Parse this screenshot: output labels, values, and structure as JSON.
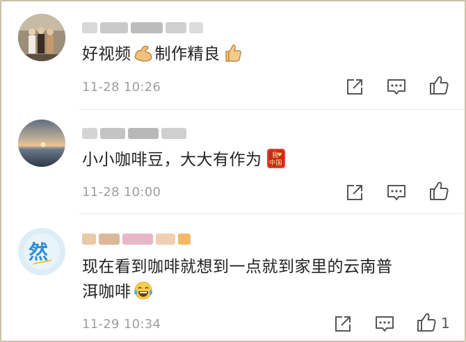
{
  "comments": [
    {
      "text": "好视频",
      "text2": "制作精良",
      "emoji1": "flexed-biceps",
      "emoji2": "thumbs-up",
      "time": "11-28 10:26"
    },
    {
      "text": "小小咖啡豆，大大有作为",
      "emoji1": "love-china-badge",
      "badge_top": "我",
      "badge_bottom": "中国",
      "time": "11-28 10:00"
    },
    {
      "text": "现在看到咖啡就想到一点就到家里的云南普",
      "text_line2": "洱咖啡",
      "emoji1": "tears-of-joy",
      "avatar_char": "然",
      "time": "11-29 10:34",
      "like_count": "1"
    }
  ],
  "icons": {
    "share": "share-icon",
    "reply": "reply-icon",
    "like": "like-icon"
  },
  "colors": {
    "meta_text": "#9e9e9e",
    "icon_stroke": "#555555",
    "frame": "#c9c1a6"
  }
}
